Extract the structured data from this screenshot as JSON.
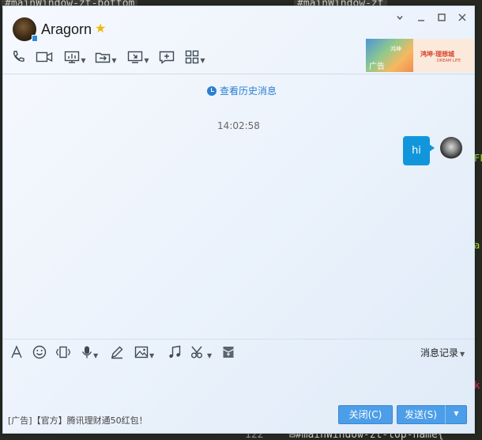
{
  "background": {
    "tab_left": "#mainWindow-zt-bottom",
    "tab_right": "#mainWindow-zt",
    "line_number": "122",
    "code_line": "⊟#mainWindow-zt-top-name{",
    "edge_right": [
      "FF",
      "a",
      "k"
    ]
  },
  "window": {
    "title": "Aragorn",
    "controls": {
      "dropdown_icon": "chevron-down-icon",
      "minimize_icon": "minimize-icon",
      "maximize_icon": "maximize-icon",
      "close_icon": "close-icon"
    },
    "vip_icon": "vip-star-icon",
    "accent_color": "#1296db"
  },
  "toolbar": {
    "icons": [
      "phone-icon",
      "video-icon",
      "screen-share-icon",
      "file-transfer-icon",
      "remote-desktop-icon",
      "new-group-icon",
      "apps-icon"
    ]
  },
  "ad_banner": {
    "tag": "广告",
    "brand_small": "鸿坤",
    "brand_name": "鸿坤·理想城",
    "brand_en": "DREAM LIFE"
  },
  "chat": {
    "history_link": "查看历史消息",
    "timestamp": "14:02:58",
    "messages": [
      {
        "from": "me",
        "text": "hi"
      }
    ]
  },
  "input_toolbar": {
    "icons": [
      "font-icon",
      "emoji-icon",
      "shake-icon",
      "voice-icon",
      "doodle-icon",
      "image-icon",
      "music-icon",
      "screenshot-icon",
      "red-packet-icon"
    ],
    "history_label": "消息记录"
  },
  "footer": {
    "ad_text": "[广告]【官方】腾讯理财通50红包！",
    "close_button": "关闭(C)",
    "send_button": "发送(S)"
  }
}
